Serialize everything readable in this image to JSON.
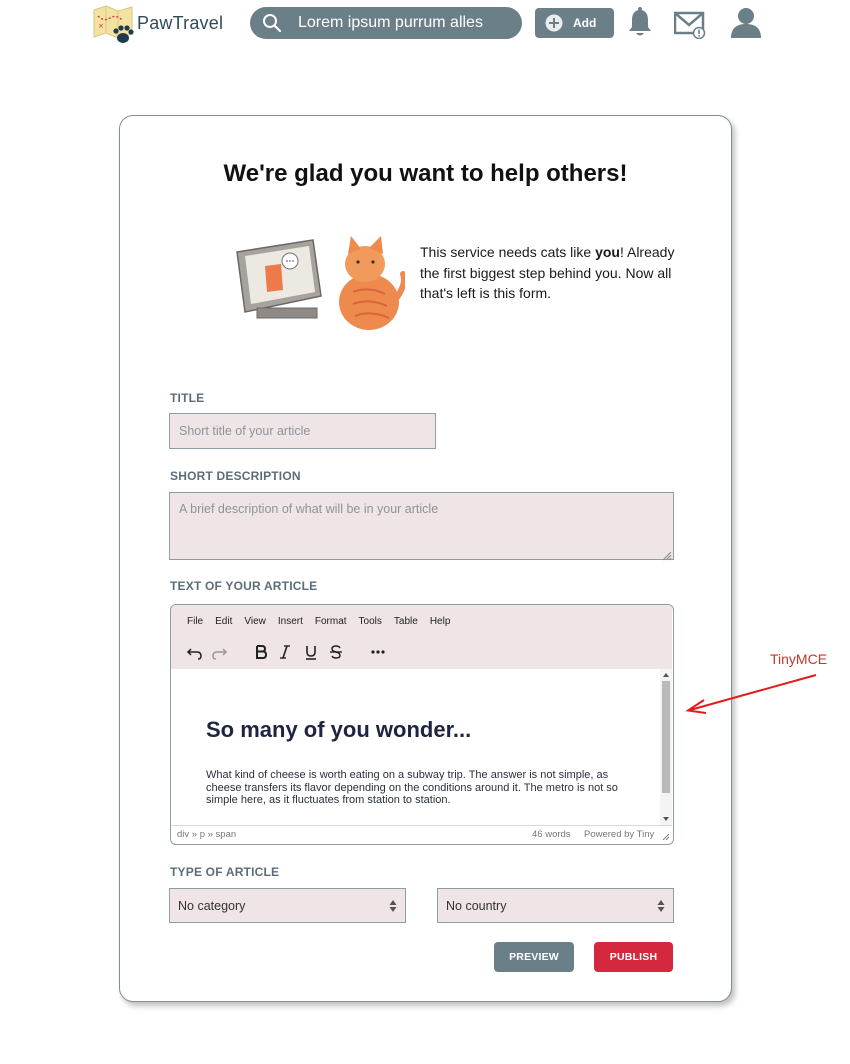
{
  "header": {
    "brand": "PawTravel",
    "search_placeholder": "Lorem ipsum purrum alles",
    "add_label": "Add"
  },
  "card": {
    "title": "We're glad you want to help others!",
    "intro_part1": "This service needs cats like ",
    "intro_bold": "you",
    "intro_part2": "! Already the first biggest step behind you. Now all that's left is this form."
  },
  "form": {
    "title_label": "TITLE",
    "title_placeholder": "Short title of your article",
    "desc_label": "SHORT DESCRIPTION",
    "desc_placeholder": "A brief description of what will be in your article",
    "text_label": "TEXT OF YOUR ARTICLE",
    "type_label": "TYPE OF ARTICLE",
    "category_value": "No category",
    "country_value": "No country",
    "preview_label": "PREVIEW",
    "publish_label": "PUBLISH"
  },
  "editor": {
    "menu": [
      "File",
      "Edit",
      "View",
      "Insert",
      "Format",
      "Tools",
      "Table",
      "Help"
    ],
    "heading": "So many of you wonder...",
    "paragraph": "What kind of cheese is worth eating on a subway trip. The answer is not simple, as cheese transfers its flavor depending on the conditions around it. The metro is not so simple here, as it fluctuates from station to station.",
    "path": "div » p » span",
    "word_count": "46 words",
    "powered_by": "Powered by Tiny"
  },
  "annotation": {
    "label": "TinyMCE"
  },
  "colors": {
    "slate": "#6b7f89",
    "brand_text": "#2f4b5a",
    "field_bg": "#efe5e7",
    "publish": "#d3283d",
    "annotation": "#c0392b"
  },
  "icons": [
    "paw-map-logo",
    "search-icon",
    "plus-circle-icon",
    "bell-icon",
    "mail-alert-icon",
    "user-icon",
    "undo-icon",
    "redo-icon",
    "bold-icon",
    "italic-icon",
    "underline-icon",
    "strikethrough-icon",
    "more-icon"
  ]
}
